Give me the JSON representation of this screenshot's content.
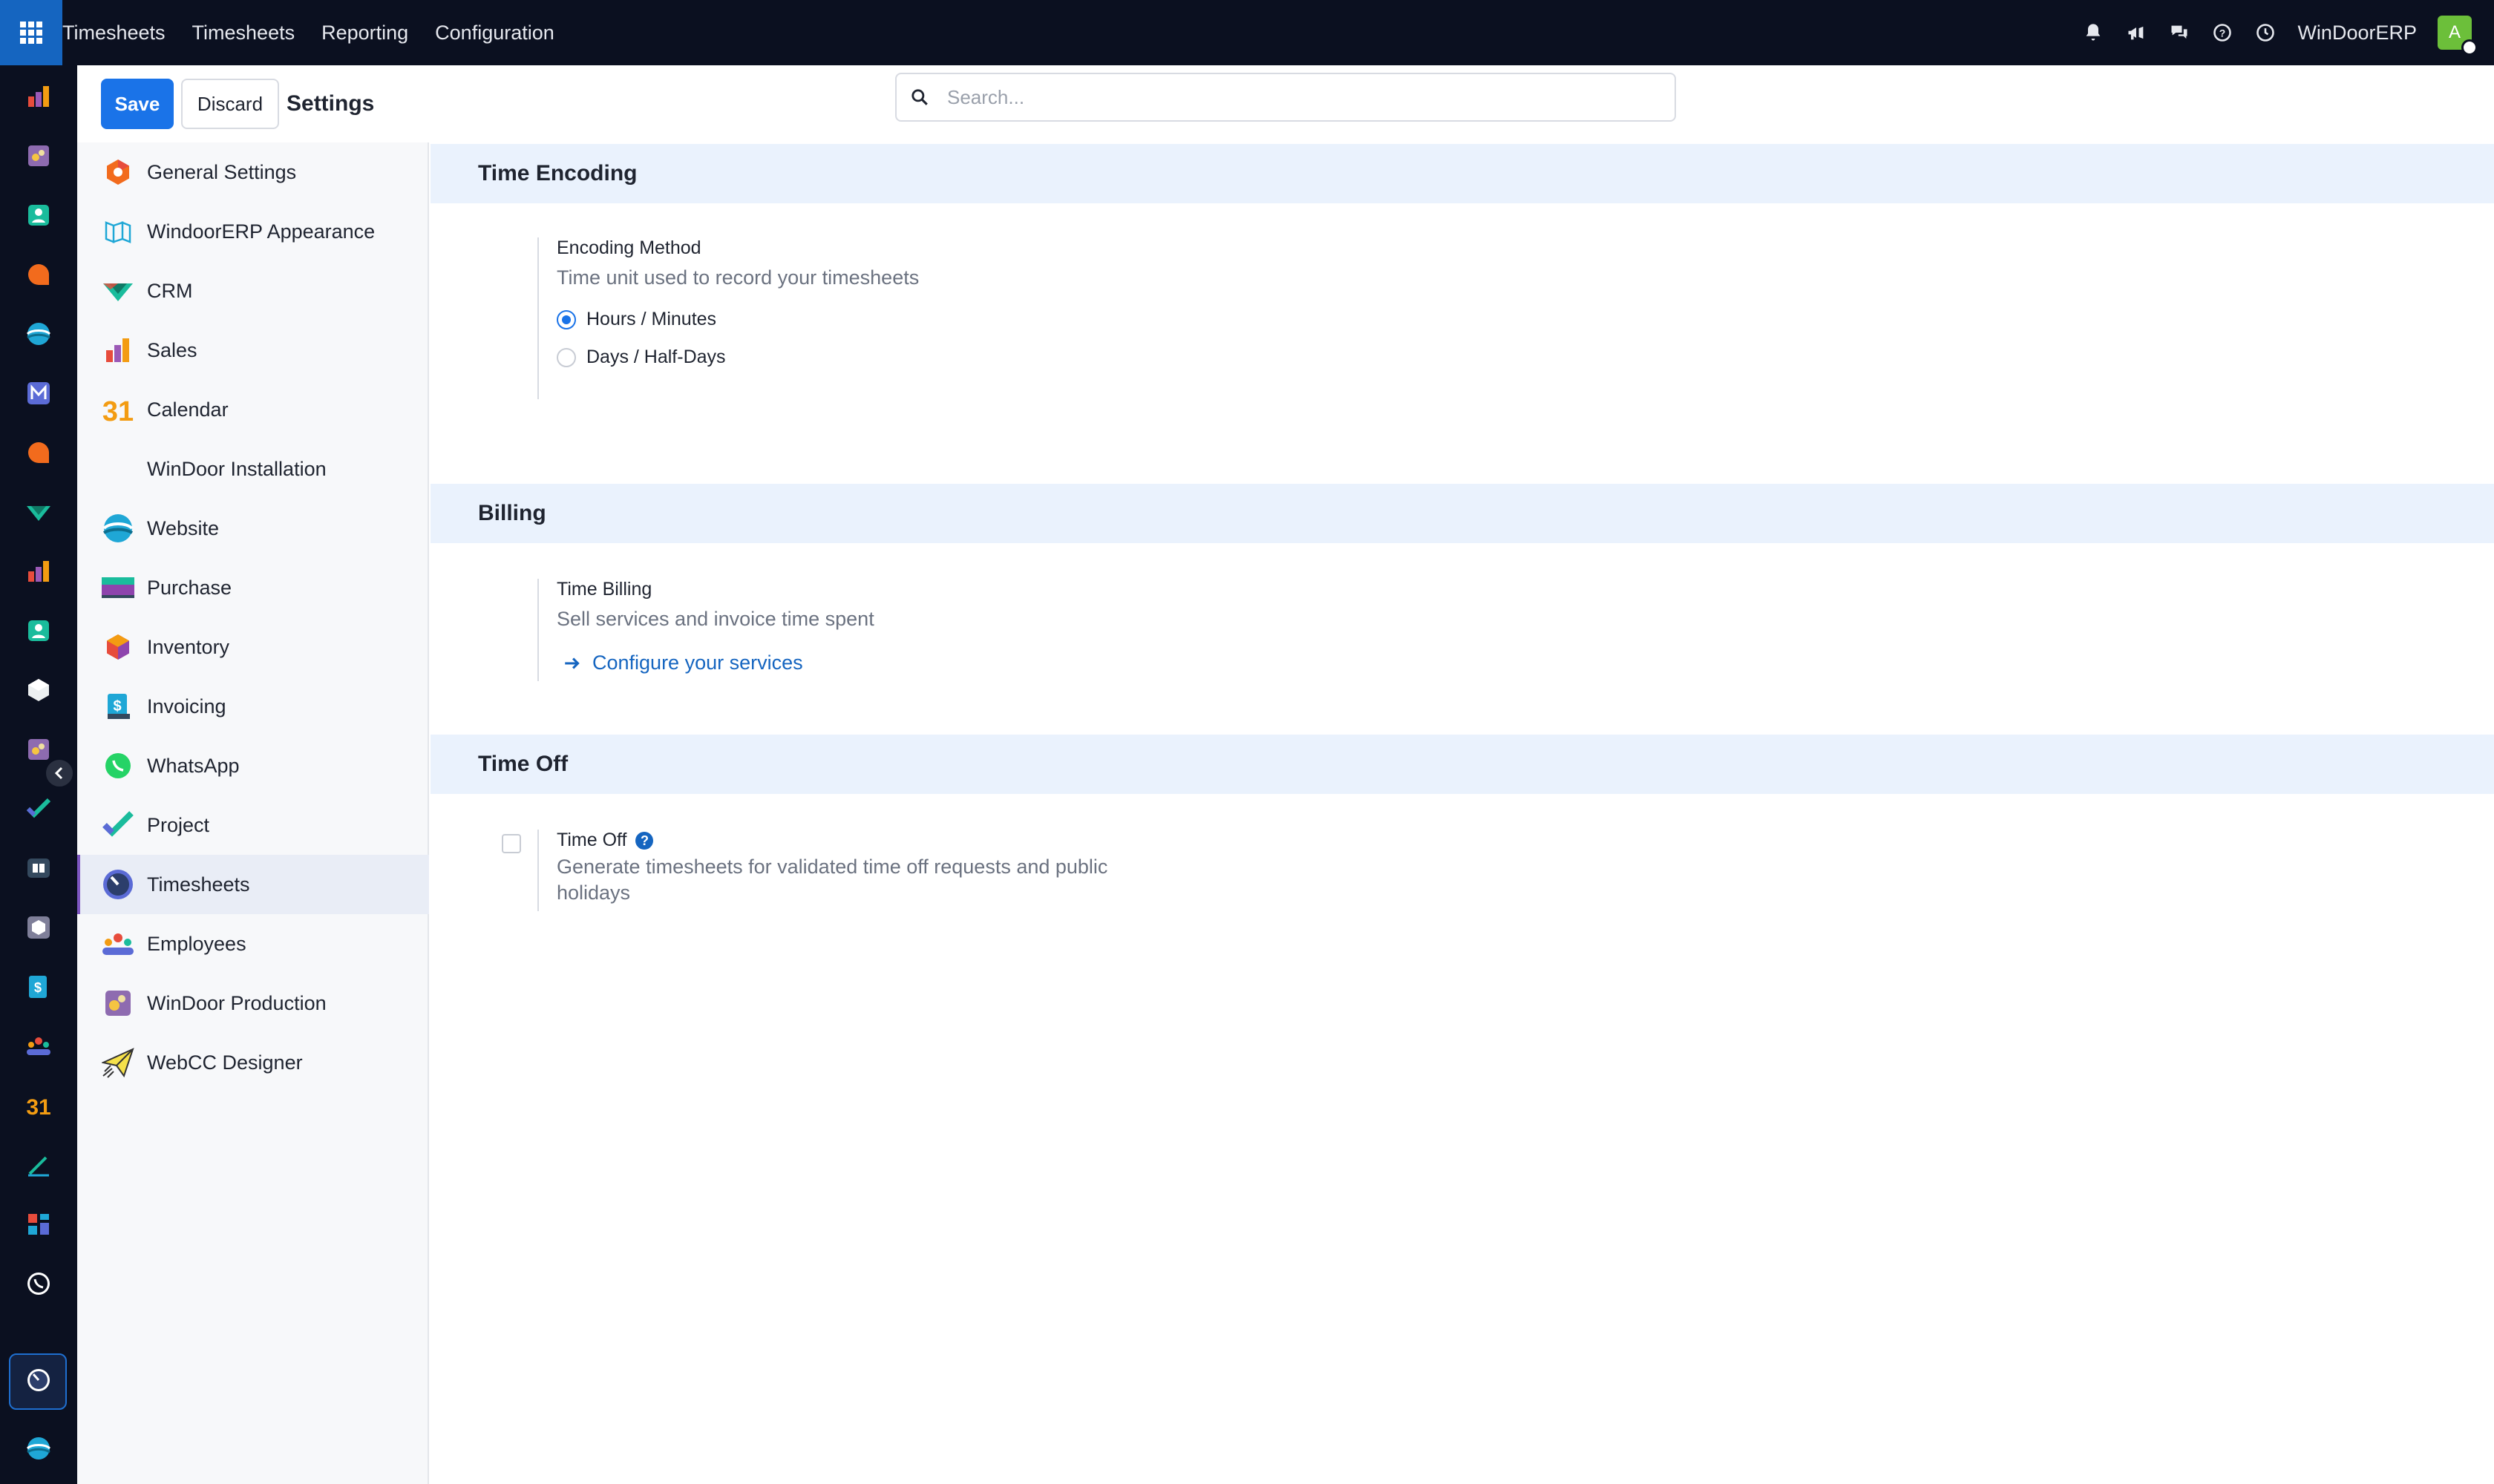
{
  "topbar": {
    "menu": [
      "Timesheets",
      "Timesheets",
      "Reporting",
      "Configuration"
    ],
    "company": "WinDoorERP",
    "avatar_initial": "A",
    "icons": [
      "bell-icon",
      "megaphone-icon",
      "chat-icon",
      "help-icon",
      "clock-icon"
    ]
  },
  "control_panel": {
    "save_label": "Save",
    "discard_label": "Discard",
    "title": "Settings",
    "search_placeholder": "Search..."
  },
  "apps": [
    {
      "label": "General Settings",
      "icon": "general-settings-icon"
    },
    {
      "label": "WindoorERP Appearance",
      "icon": "appearance-icon"
    },
    {
      "label": "CRM",
      "icon": "crm-icon"
    },
    {
      "label": "Sales",
      "icon": "sales-icon"
    },
    {
      "label": "Calendar",
      "icon": "calendar-icon"
    },
    {
      "label": "WinDoor Installation",
      "icon": ""
    },
    {
      "label": "Website",
      "icon": "website-icon"
    },
    {
      "label": "Purchase",
      "icon": "purchase-icon"
    },
    {
      "label": "Inventory",
      "icon": "inventory-icon"
    },
    {
      "label": "Invoicing",
      "icon": "invoicing-icon"
    },
    {
      "label": "WhatsApp",
      "icon": "whatsapp-icon"
    },
    {
      "label": "Project",
      "icon": "project-icon"
    },
    {
      "label": "Timesheets",
      "icon": "timesheets-icon",
      "active": true
    },
    {
      "label": "Employees",
      "icon": "employees-icon"
    },
    {
      "label": "WinDoor Production",
      "icon": "production-icon"
    },
    {
      "label": "WebCC Designer",
      "icon": "webcc-designer-icon"
    }
  ],
  "sections": {
    "time_encoding": {
      "title": "Time Encoding",
      "setting_title": "Encoding Method",
      "setting_desc": "Time unit used to record your timesheets",
      "options": [
        "Hours / Minutes",
        "Days / Half-Days"
      ],
      "selected": "Hours / Minutes"
    },
    "billing": {
      "title": "Billing",
      "setting_title": "Time Billing",
      "setting_desc": "Sell services and invoice time spent",
      "link": "Configure your services"
    },
    "time_off": {
      "title": "Time Off",
      "setting_title": "Time Off",
      "help": "?",
      "setting_desc_line1": "Generate timesheets for validated time off requests and public",
      "setting_desc_line2": "holidays",
      "checked": false
    }
  },
  "colors": {
    "navbar": "#0b1020",
    "accent": "#1a73e8",
    "section_header": "#eaf2fd",
    "active_app": "#7e57c2"
  }
}
